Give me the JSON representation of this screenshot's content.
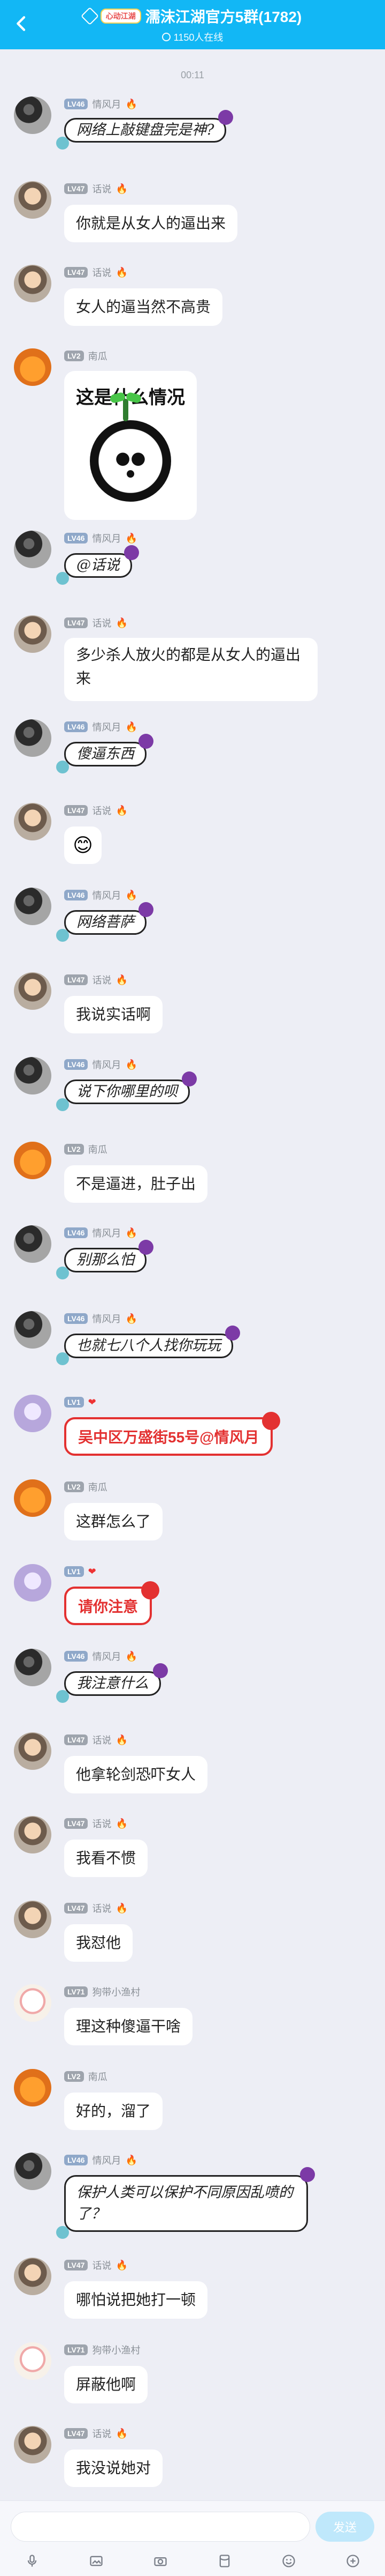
{
  "header": {
    "brand": "心动江湖",
    "title": "濡沫江湖官方5群(1782)",
    "subtitle": "1150人在线"
  },
  "time": "00:11",
  "messages": [
    {
      "avatar": "av-dark",
      "lv": "LV46",
      "name": "情风月",
      "bubble": "网络上敲键盘完是神?",
      "kind": "deco"
    },
    {
      "avatar": "av-boy",
      "lv": "LV47",
      "name": "话说",
      "bubble": "你就是从女人的逼出来",
      "kind": "text"
    },
    {
      "avatar": "av-boy",
      "lv": "LV47",
      "name": "话说",
      "bubble": "女人的逼当然不高贵",
      "kind": "text"
    },
    {
      "avatar": "av-pumpkin",
      "lv": "LV2",
      "name": "南瓜",
      "bubble": "这是什么情况",
      "kind": "sticker"
    },
    {
      "avatar": "av-dark",
      "lv": "LV46",
      "name": "情风月",
      "bubble": "@话说",
      "kind": "deco"
    },
    {
      "avatar": "av-boy",
      "lv": "LV47",
      "name": "话说",
      "bubble": "多少杀人放火的都是从女人的逼出来",
      "kind": "text"
    },
    {
      "avatar": "av-dark",
      "lv": "LV46",
      "name": "情风月",
      "bubble": "傻逼东西",
      "kind": "deco"
    },
    {
      "avatar": "av-boy",
      "lv": "LV47",
      "name": "话说",
      "bubble": "😊",
      "kind": "emoji"
    },
    {
      "avatar": "av-dark",
      "lv": "LV46",
      "name": "情风月",
      "bubble": "网络菩萨",
      "kind": "deco"
    },
    {
      "avatar": "av-boy",
      "lv": "LV47",
      "name": "话说",
      "bubble": "我说实话啊",
      "kind": "text"
    },
    {
      "avatar": "av-dark",
      "lv": "LV46",
      "name": "情风月",
      "bubble": "说下你哪里的呗",
      "kind": "deco"
    },
    {
      "avatar": "av-pumpkin",
      "lv": "LV2",
      "name": "南瓜",
      "bubble": "不是逼进，肚子出",
      "kind": "text"
    },
    {
      "avatar": "av-dark",
      "lv": "LV46",
      "name": "情风月",
      "bubble": "别那么怕",
      "kind": "deco"
    },
    {
      "avatar": "av-dark",
      "lv": "LV46",
      "name": "情风月",
      "bubble": "也就七八个人找你玩玩",
      "kind": "deco"
    },
    {
      "avatar": "av-purple",
      "lv": "LV1",
      "name": "",
      "bubble": "吴中区万盛街55号@情风月",
      "kind": "redtag"
    },
    {
      "avatar": "av-pumpkin",
      "lv": "LV2",
      "name": "南瓜",
      "bubble": "这群怎么了",
      "kind": "text"
    },
    {
      "avatar": "av-purple",
      "lv": "LV1",
      "name": "",
      "bubble": "请你注意",
      "kind": "redtag"
    },
    {
      "avatar": "av-dark",
      "lv": "LV46",
      "name": "情风月",
      "bubble": "我注意什么",
      "kind": "deco"
    },
    {
      "avatar": "av-boy",
      "lv": "LV47",
      "name": "话说",
      "bubble": "他拿轮剑恐吓女人",
      "kind": "text"
    },
    {
      "avatar": "av-boy",
      "lv": "LV47",
      "name": "话说",
      "bubble": "我看不惯",
      "kind": "text"
    },
    {
      "avatar": "av-boy",
      "lv": "LV47",
      "name": "话说",
      "bubble": "我怼他",
      "kind": "text"
    },
    {
      "avatar": "av-cartoon",
      "lv": "LV71",
      "name": "狗带小渔村",
      "bubble": "理这种傻逼干啥",
      "kind": "text"
    },
    {
      "avatar": "av-pumpkin",
      "lv": "LV2",
      "name": "南瓜",
      "bubble": "好的，溜了",
      "kind": "text"
    },
    {
      "avatar": "av-dark",
      "lv": "LV46",
      "name": "情风月",
      "bubble": "保护人类可以保护不同原因乱喷的了？",
      "kind": "deco"
    },
    {
      "avatar": "av-boy",
      "lv": "LV47",
      "name": "话说",
      "bubble": "哪怕说把她打一顿",
      "kind": "text"
    },
    {
      "avatar": "av-cartoon",
      "lv": "LV71",
      "name": "狗带小渔村",
      "bubble": "屏蔽他啊",
      "kind": "text"
    },
    {
      "avatar": "av-boy",
      "lv": "LV47",
      "name": "话说",
      "bubble": "我没说她对",
      "kind": "text"
    }
  ],
  "input": {
    "send_label": "发送"
  }
}
